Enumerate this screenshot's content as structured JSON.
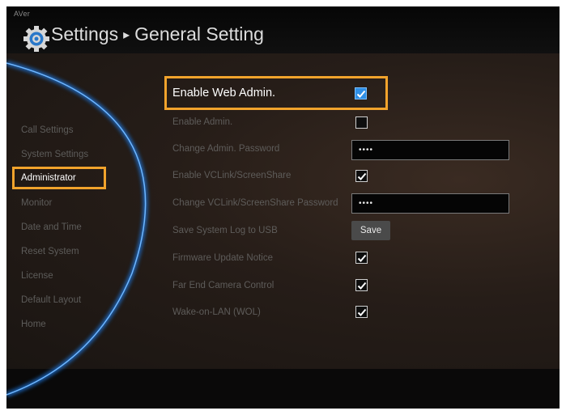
{
  "brand": "AVer",
  "header": {
    "title": "Settings",
    "separator": "▸",
    "subtitle": "General Setting"
  },
  "sidebar": {
    "items": [
      {
        "label": "Call Settings"
      },
      {
        "label": "System Settings"
      },
      {
        "label": "Administrator"
      },
      {
        "label": "Monitor"
      },
      {
        "label": "Date and Time"
      },
      {
        "label": "Reset System"
      },
      {
        "label": "License"
      },
      {
        "label": "Default Layout"
      },
      {
        "label": "Home"
      }
    ],
    "selected": "Administrator"
  },
  "settings": {
    "enable_web_admin": {
      "label": "Enable Web Admin.",
      "checked": true
    },
    "enable_admin": {
      "label": "Enable Admin.",
      "checked": false
    },
    "change_admin_password": {
      "label": "Change Admin. Password",
      "value": "••••"
    },
    "enable_vclink": {
      "label": "Enable VCLink/ScreenShare",
      "checked": true
    },
    "change_vclink_password": {
      "label": "Change VCLink/ScreenShare Password",
      "value": "••••"
    },
    "save_log": {
      "label": "Save System Log to USB",
      "button": "Save"
    },
    "firmware_notice": {
      "label": "Firmware Update Notice",
      "checked": true
    },
    "far_end_camera": {
      "label": "Far End Camera Control",
      "checked": true
    },
    "wake_on_lan": {
      "label": "Wake-on-LAN (WOL)",
      "checked": true
    }
  },
  "colors": {
    "highlight": "#f1a32c",
    "arc": "#2e7fd6",
    "checkbox_focus": "#2f8fe6"
  }
}
